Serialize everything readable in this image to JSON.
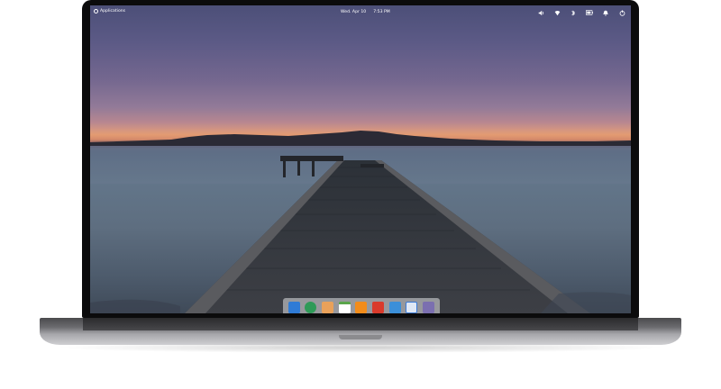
{
  "panel": {
    "applications_label": "Applications",
    "date": "Wed. Apr 10",
    "time": "7:53 PM",
    "indicators": [
      "volume-icon",
      "network-icon",
      "bluetooth-icon",
      "battery-icon",
      "notifications-icon",
      "power-icon"
    ]
  },
  "dock": {
    "apps": [
      {
        "name": "files-icon",
        "color": "#2f7bd6"
      },
      {
        "name": "web-browser-icon",
        "color": "#2e9a57"
      },
      {
        "name": "mail-icon",
        "color": "#e9a15a"
      },
      {
        "name": "calendar-icon",
        "color": "#5aa54b"
      },
      {
        "name": "music-icon",
        "color": "#f28c1b"
      },
      {
        "name": "videos-icon",
        "color": "#d93a2b"
      },
      {
        "name": "photos-icon",
        "color": "#3b8fd9"
      },
      {
        "name": "appcenter-icon",
        "color": "#3a7ad6"
      },
      {
        "name": "settings-icon",
        "color": "#7b6fb0"
      }
    ]
  },
  "colors": {
    "sky_top": "#4c4f78",
    "horizon": "#e39b72",
    "water": "#5e6e80",
    "bezel": "#0b0b0c"
  }
}
